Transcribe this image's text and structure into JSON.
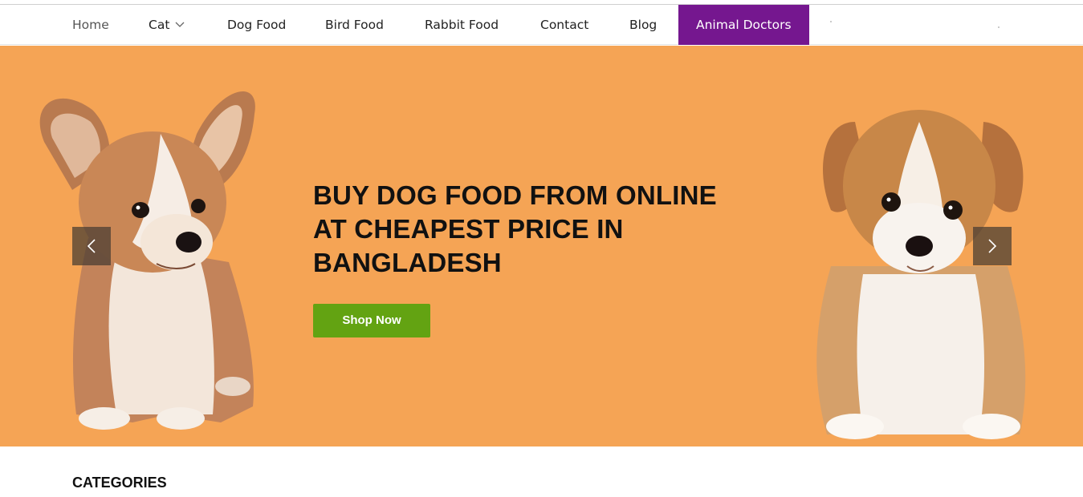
{
  "nav": {
    "items": [
      {
        "label": "Home"
      },
      {
        "label": "Cat"
      },
      {
        "label": "Dog Food"
      },
      {
        "label": "Bird Food"
      },
      {
        "label": "Rabbit Food"
      },
      {
        "label": "Contact"
      },
      {
        "label": "Blog"
      },
      {
        "label": "Animal Doctors"
      }
    ],
    "active_color": "#75178f"
  },
  "hero": {
    "headline_lines": [
      "BUY DOG FOOD FROM ONLINE",
      "AT CHEAPEST PRICE IN",
      "BANGLADESH"
    ],
    "cta_label": "Shop Now",
    "background_color": "#f5a455",
    "cta_color": "#63a312",
    "prev_icon": "chevron-left-icon",
    "next_icon": "chevron-right-icon"
  },
  "sections": {
    "categories_title": "CATEGORIES"
  }
}
